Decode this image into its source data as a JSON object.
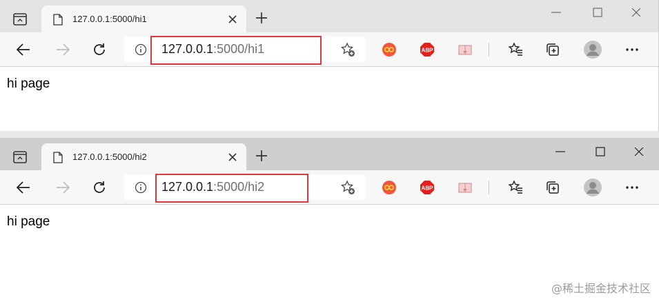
{
  "windows": [
    {
      "tab_title": "127.0.0.1:5000/hi1",
      "url_host": "127.0.0.1",
      "url_path": ":5000/hi1",
      "page_text": "hi page"
    },
    {
      "tab_title": "127.0.0.1:5000/hi2",
      "url_host": "127.0.0.1",
      "url_path": ":5000/hi2",
      "page_text": "hi page"
    }
  ],
  "extensions": {
    "abp_label": "ABP"
  },
  "highlight_color": "#e0373f",
  "watermark": "@稀土掘金技术社区"
}
